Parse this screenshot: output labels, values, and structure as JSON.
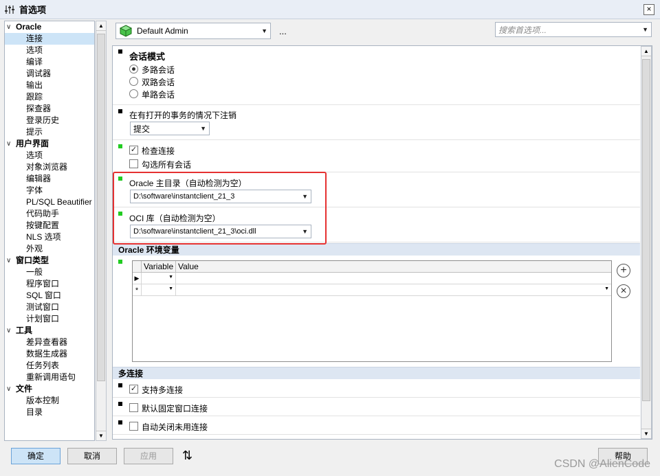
{
  "window": {
    "title": "首选项",
    "close": "×"
  },
  "tree": {
    "groups": [
      {
        "label": "Oracle",
        "items": [
          "连接",
          "选项",
          "编译",
          "调试器",
          "输出",
          "跟踪",
          "探查器",
          "登录历史",
          "提示"
        ]
      },
      {
        "label": "用户界面",
        "items": [
          "选项",
          "对象浏览器",
          "编辑器",
          "字体",
          "PL/SQL Beautifier",
          "代码助手",
          "按键配置",
          "NLS 选项",
          "外观"
        ]
      },
      {
        "label": "窗口类型",
        "items": [
          "一般",
          "程序窗口",
          "SQL 窗口",
          "测试窗口",
          "计划窗口"
        ]
      },
      {
        "label": "工具",
        "items": [
          "差异查看器",
          "数据生成器",
          "任务列表",
          "重新调用语句"
        ]
      },
      {
        "label": "文件",
        "items": [
          "版本控制",
          "目录"
        ]
      }
    ],
    "selected": "连接"
  },
  "toolbar": {
    "profile": "Default Admin",
    "more": "...",
    "search_placeholder": "搜索首选项..."
  },
  "session_mode": {
    "title": "会话模式",
    "options": [
      "多路会话",
      "双路会话",
      "单路会话"
    ],
    "selected": "多路会话"
  },
  "logoff": {
    "title": "在有打开的事务的情况下注销",
    "value": "提交"
  },
  "check_connection": {
    "label": "检查连接",
    "checked": true
  },
  "check_all_sessions": {
    "label": "勾选所有会话",
    "checked": false
  },
  "oracle_home": {
    "title": "Oracle 主目录（自动检测为空）",
    "value": "D:\\software\\instantclient_21_3"
  },
  "oci_library": {
    "title": "OCI 库（自动检测为空）",
    "value": "D:\\software\\instantclient_21_3\\oci.dll"
  },
  "oracle_env": {
    "title": "Oracle 环境变量",
    "columns": [
      "Variable",
      "Value"
    ],
    "add": "+",
    "remove": "×"
  },
  "multi_connection": {
    "title": "多连接",
    "items": [
      {
        "label": "支持多连接",
        "checked": true
      },
      {
        "label": "默认固定窗口连接",
        "checked": false
      },
      {
        "label": "自动关闭未用连接",
        "checked": false
      }
    ]
  },
  "buttons": {
    "ok": "确定",
    "cancel": "取消",
    "apply": "应用",
    "sort": "⇅",
    "help": "帮助"
  },
  "watermark": "CSDN @AlienCode",
  "colors": {
    "accent": "#cde4f7",
    "highlight": "#e53030",
    "changed_marker": "#22cc22"
  }
}
